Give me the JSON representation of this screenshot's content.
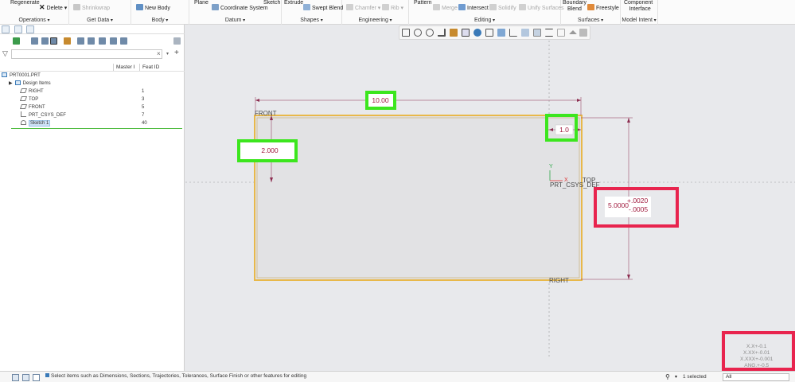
{
  "ribbon": {
    "operations": {
      "regenerate": "Regenerate",
      "delete": "Delete",
      "title": "Operations"
    },
    "get_data": {
      "shrinkwrap": "Shrinkwrap",
      "title": "Get Data"
    },
    "body": {
      "new_body": "New Body",
      "title": "Body"
    },
    "datum": {
      "plane": "Plane",
      "coordinate_system": "Coordinate System",
      "sketch": "Sketch",
      "title": "Datum"
    },
    "shapes": {
      "extrude": "Extrude",
      "swept_blend": "Swept Blend",
      "title": "Shapes"
    },
    "engineering": {
      "chamfer": "Chamfer",
      "rib": "Rib",
      "title": "Engineering"
    },
    "editing": {
      "pattern": "Pattern",
      "merge": "Merge",
      "intersect": "Intersect",
      "solidify": "Solidify",
      "unify_surfaces": "Unify Surfaces",
      "title": "Editing"
    },
    "surfaces": {
      "boundary_blend_1": "Boundary",
      "boundary_blend_2": "Blend",
      "freestyle": "Freestyle",
      "title": "Surfaces"
    },
    "model_intent": {
      "component_1": "Component",
      "component_2": "Interface",
      "title": "Model Intent"
    }
  },
  "tree": {
    "columns": {
      "master": "Master I",
      "feat_id": "Feat ID"
    },
    "items": [
      {
        "label": "PRT0001.PRT",
        "id": ""
      },
      {
        "label": "Design Items",
        "id": ""
      },
      {
        "label": "RIGHT",
        "id": "1"
      },
      {
        "label": "TOP",
        "id": "3"
      },
      {
        "label": "FRONT",
        "id": "5"
      },
      {
        "label": "PRT_CSYS_DEF",
        "id": "7"
      },
      {
        "label": "Sketch 1",
        "id": "40"
      }
    ]
  },
  "sketch": {
    "dim_width": "10.00",
    "dim_height": "2.000",
    "dim_small": "1.0",
    "dim_main": "5.0000",
    "tol_plus": "+.0020",
    "tol_minus": "-.0005",
    "label_front": "FRONT",
    "label_top": "TOP",
    "label_csys": "PRT_CSYS_DEF",
    "label_right": "RIGHT",
    "axis_y": "Y",
    "axis_x": "X",
    "highlight_green": "#3ce61e",
    "highlight_red": "#e8244e"
  },
  "tolerance_table": [
    "X.X+-0.1",
    "X.XX+-0.01",
    "X.XXX+-0.001",
    "ANG.+-0.5"
  ],
  "statusbar": {
    "message": "Select items such as Dimensions, Sections, Trajectories, Tolerances, Surface Finish or other features for editing",
    "selected": "1 selected",
    "filter": "All"
  }
}
